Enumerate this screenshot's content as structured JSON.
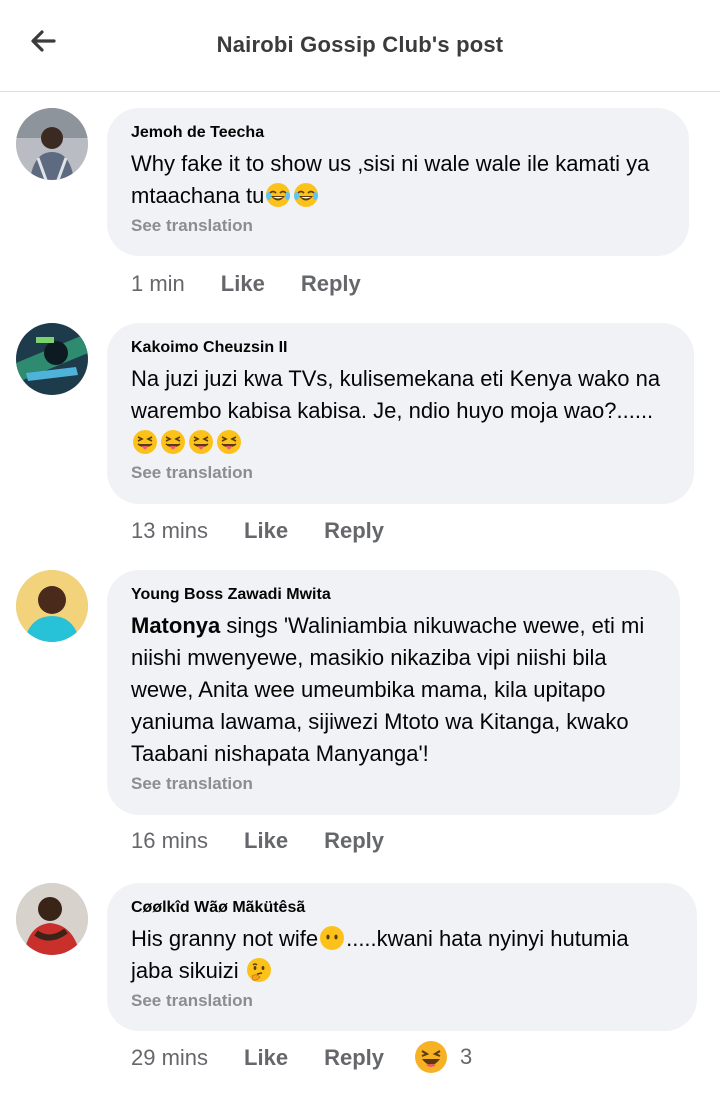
{
  "header": {
    "title": "Nairobi Gossip Club's post",
    "back_icon": "arrow-left-icon"
  },
  "comments": [
    {
      "author": "Jemoh de Teecha",
      "text_before": "Why fake it to show us ,sisi ni wale wale ile kamati ya mtaachana tu",
      "emoji": "face-with-tears-of-joy",
      "see_translation": "See translation",
      "time": "1 min",
      "like": "Like",
      "reply": "Reply"
    },
    {
      "author": "Kakoimo Cheuzsin II",
      "text_before": "Na juzi juzi kwa TVs, kulisemekana eti Kenya wako na warembo kabisa kabisa. Je, ndio huyo moja wao?......",
      "emoji": "winking-face-with-tongue",
      "see_translation": "See translation",
      "time": "13 mins",
      "like": "Like",
      "reply": "Reply"
    },
    {
      "author": "Young Boss Zawadi Mwita",
      "tagged": "Matonya",
      "text_after": " sings 'Waliniambia nikuwache wewe, eti mi niishi mwenyewe, masikio nikaziba vipi niishi bila wewe, Anita wee umeumbika mama, kila upitapo yaniuma lawama, sijiwezi Mtoto wa Kitanga, kwako Taabani nishapata Manyanga'!",
      "see_translation": "See translation",
      "time": "16 mins",
      "like": "Like",
      "reply": "Reply"
    },
    {
      "author": "Cøølkîd Wãø Mãkütêsã",
      "text_before": "His granny not wife",
      "text_middle": ".....kwani hata nyinyi hutumia jaba sikuizi ",
      "emoji_1": "face-without-mouth",
      "emoji_2": "thinking-face",
      "see_translation": "See translation",
      "time": "29 mins",
      "like": "Like",
      "reply": "Reply",
      "reaction_icon": "haha-reaction-icon",
      "reaction_count": "3"
    }
  ]
}
